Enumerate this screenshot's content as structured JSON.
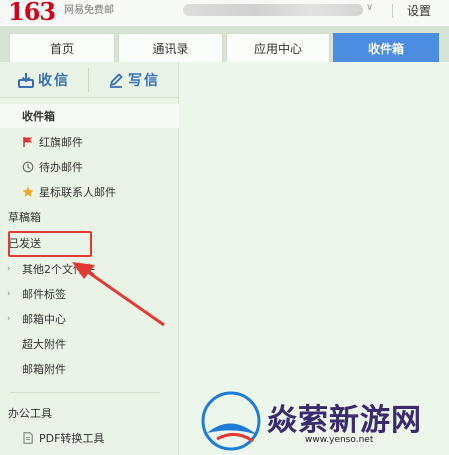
{
  "header": {
    "logo_number": "163",
    "logo_subtitle": "网易免费邮",
    "settings_label": "设置"
  },
  "tabs": [
    {
      "label": "首页",
      "active": false
    },
    {
      "label": "通讯录",
      "active": false
    },
    {
      "label": "应用中心",
      "active": false
    },
    {
      "label": "收件箱",
      "active": true
    }
  ],
  "actions": {
    "receive_label": "收信",
    "compose_label": "写信"
  },
  "sidebar": {
    "inbox": "收件箱",
    "red_flag": "红旗邮件",
    "todo": "待办邮件",
    "starred": "星标联系人邮件",
    "drafts": "草稿箱",
    "sent": "已发送",
    "other_folders": "其他2个文件夹",
    "mail_tags": "邮件标签",
    "mailbox_center": "邮箱中心",
    "large_attachments": "超大附件",
    "mail_attachments": "邮箱附件",
    "office_tools": "办公工具",
    "pdf_tool": "PDF转换工具"
  },
  "watermark": {
    "brand": "焱萦新游网",
    "url": "www.yenso.net"
  },
  "colors": {
    "active_tab": "#4c8de2",
    "logo_red": "#d6001c",
    "annotation_red": "#e53935",
    "action_blue": "#3a6fb5"
  }
}
